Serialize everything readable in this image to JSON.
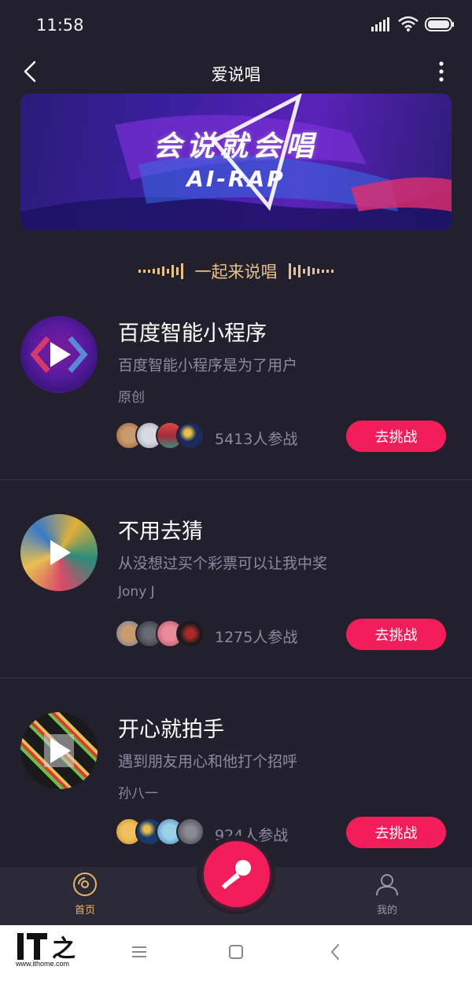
{
  "status_bar": {
    "time": "11:58"
  },
  "nav": {
    "title": "爱说唱"
  },
  "banner": {
    "title": "会说就会唱",
    "subtitle": "AI-RAP"
  },
  "section": {
    "heading": "一起来说唱"
  },
  "songs": [
    {
      "title": "百度智能小程序",
      "description": "百度智能小程序是为了用户",
      "artist": "原创",
      "participants": "5413人参战",
      "button": "去挑战",
      "cover_icon": "baidu-smart-program-logo",
      "cover_colors": [
        "#5a1aa0",
        "#c42a74"
      ]
    },
    {
      "title": "不用去猜",
      "description": "从没想过买个彩票可以让我中奖",
      "artist": "Jony J",
      "participants": "1275人参战",
      "button": "去挑战",
      "cover_icon": "album-art-jony-j",
      "cover_colors": [
        "#e0b03a",
        "#2a8c7a"
      ]
    },
    {
      "title": "开心就拍手",
      "description": "遇到朋友用心和他打个招呼",
      "artist": "孙八一",
      "participants": "924人参战",
      "button": "去挑战",
      "cover_icon": "album-art-colorful",
      "cover_colors": [
        "#1a1a1a",
        "#6cc04a"
      ]
    }
  ],
  "tab_bar": {
    "home_label": "首页",
    "mine_label": "我的",
    "home_icon": "vinyl-disc-icon",
    "mine_icon": "user-icon",
    "center_icon": "microphone-icon"
  },
  "watermark": {
    "logo": "IT之家",
    "url": "www.ithome.com"
  },
  "colors": {
    "background": "#22202c",
    "accent": "#f41d5c",
    "gold": "#e8c08c",
    "muted_text": "#8c8aa2"
  }
}
